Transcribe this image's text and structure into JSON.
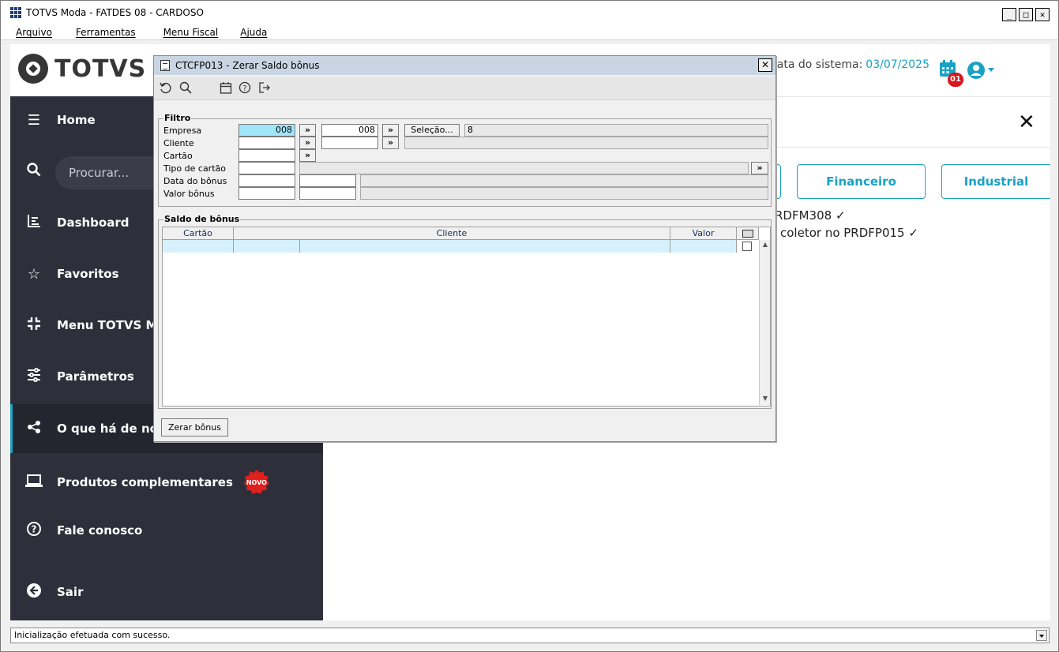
{
  "window": {
    "title": "TOTVS Moda - FATDES 08 - CARDOSO",
    "minimize": "_",
    "maximize": "□",
    "close": "✕"
  },
  "menubar": {
    "items": [
      {
        "label": "Arquivo"
      },
      {
        "label": "Ferramentas"
      },
      {
        "label": "Menu Fiscal"
      },
      {
        "label": "Ajuda"
      }
    ]
  },
  "web": {
    "logo_text": "TOTVS",
    "system_date_label": "Data do sistema:",
    "system_date": "03/07/2025",
    "calendar_badge": "01",
    "close": "✕",
    "search_placeholder": "Procurar...",
    "nav": [
      {
        "label": "Home",
        "icon": "menu-icon"
      },
      {
        "label": "Dashboard",
        "icon": "chart-icon"
      },
      {
        "label": "Favoritos",
        "icon": "star-icon"
      },
      {
        "label": "Menu TOTVS Moda",
        "icon": "compress-icon"
      },
      {
        "label": "Parâmetros",
        "icon": "sliders-icon"
      },
      {
        "label": "O que há de novo?",
        "icon": "share-icon"
      },
      {
        "label": "Produtos complementares",
        "icon": "laptop-icon",
        "badge": "NOVO"
      },
      {
        "label": "Fale conosco",
        "icon": "help-icon"
      },
      {
        "label": "Sair",
        "icon": "exit-icon"
      }
    ],
    "tiles": [
      {
        "label": "Financeiro"
      },
      {
        "label": "Industrial"
      }
    ],
    "news": [
      {
        "text": "RDFM308 ✓"
      },
      {
        "text": "coletor no PRDFP015 ✓"
      }
    ]
  },
  "dialog": {
    "title": "CTCFP013 - Zerar Saldo bônus",
    "close": "✕",
    "filtro": {
      "legend": "Filtro",
      "labels": {
        "empresa": "Empresa",
        "cliente": "Cliente",
        "cartao": "Cartão",
        "tipo_cartao": "Tipo de cartão",
        "data_bonus": "Data do bônus",
        "valor_bonus": "Valor bônus"
      },
      "empresa_from": "008",
      "empresa_to": "008",
      "selecao_label": "Seleção...",
      "selecao_value": "8",
      "arrow": "»"
    },
    "saldo": {
      "legend": "Saldo de bônus",
      "columns": [
        "Cartão",
        "Cliente",
        "Valor"
      ]
    },
    "zerar_label": "Zerar bônus"
  },
  "status": {
    "message": "Inicialização efetuada com sucesso."
  }
}
